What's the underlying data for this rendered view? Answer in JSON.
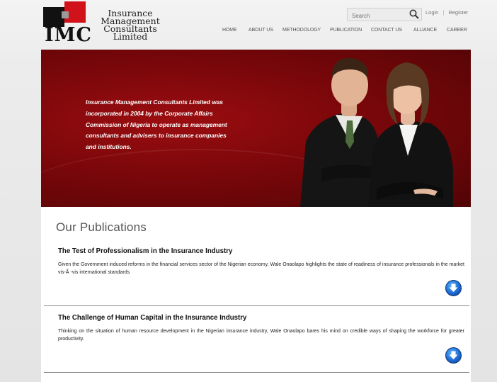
{
  "logo": {
    "initials": "IMC",
    "company_lines": [
      "Insurance",
      "Management",
      "Consultants",
      "Limited"
    ]
  },
  "search": {
    "placeholder": "Search"
  },
  "top_links": {
    "login": "Login",
    "separator": "|",
    "register": "Register"
  },
  "nav": [
    "HOME",
    "ABOUT US",
    "METHODOLOGY",
    "PUBLICATION",
    "CONTACT US",
    "ALLIANCE",
    "CAREER"
  ],
  "hero": {
    "lines": [
      "Insurance Management Consultants Limited was",
      "incorporated in 2004 by the Corporate Affairs",
      "Commission of Nigeria to operate as management",
      "consultants and advisers to insurance companies",
      "and institutions."
    ]
  },
  "publications": {
    "title": "Our Publications",
    "items": [
      {
        "title": "The Test of Professionalism in the Insurance Industry",
        "summary": "Given the Government induced reforms in the financial services sector of the Nigerian economy, Wale Onaolapo highlights the state of readiness of insurance professionals in the market vis-Ã -vis international standards"
      },
      {
        "title": "The Challenge of Human Capital in the Insurance Industry",
        "summary": "Thinking on the situation of human resource development in the Nigerian insurance industry, Wale Onaolapo bares his mind on credible ways of shaping the workforce for greater productivity."
      }
    ]
  },
  "colors": {
    "hero_red": "#8b0a0d",
    "logo_red": "#d2121b",
    "download_blue": "#1d6ad2"
  },
  "icons": {
    "search": "search-icon",
    "download": "download-arrow-icon"
  }
}
